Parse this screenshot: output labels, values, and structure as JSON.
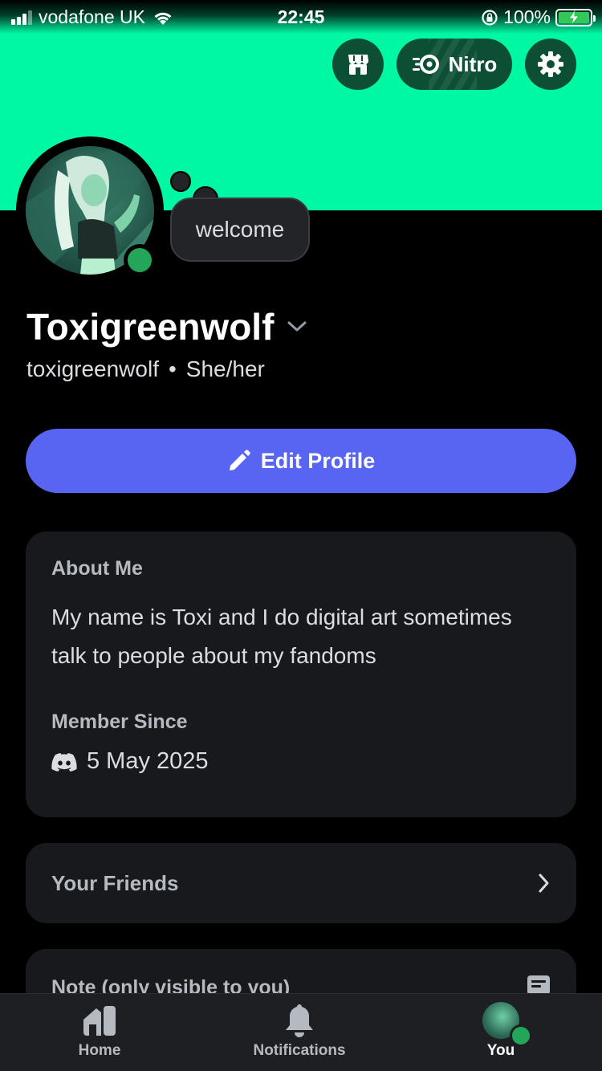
{
  "status_bar": {
    "carrier": "vodafone UK",
    "time": "22:45",
    "battery_percent": "100%"
  },
  "header": {
    "nitro_label": "Nitro",
    "banner_color": "#00f7a3"
  },
  "profile": {
    "custom_status": "welcome",
    "display_name": "Toxigreenwolf",
    "username": "toxigreenwolf",
    "separator": "•",
    "pronouns": "She/her",
    "online_status": "online",
    "status_color": "#23a55a"
  },
  "edit_profile": {
    "label": "Edit Profile",
    "color": "#5865f2"
  },
  "about": {
    "title": "About Me",
    "text": "My name is Toxi and I do digital art sometimes talk to people about my fandoms",
    "member_since_title": "Member Since",
    "member_since_date": "5 May 2025"
  },
  "friends": {
    "label": "Your Friends"
  },
  "note": {
    "label": "Note (only visible to you)"
  },
  "bottom_nav": {
    "items": [
      {
        "label": "Home",
        "icon": "home-icon"
      },
      {
        "label": "Notifications",
        "icon": "bell-icon"
      },
      {
        "label": "You",
        "icon": "avatar"
      }
    ]
  }
}
